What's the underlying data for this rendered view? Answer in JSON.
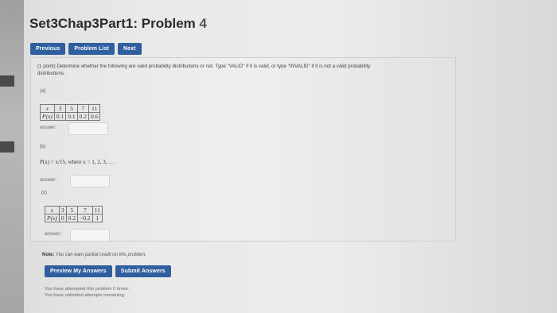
{
  "header": {
    "title": "Set3Chap3Part1: Problem",
    "problem_number": "4"
  },
  "nav": {
    "previous": "Previous",
    "problem_list": "Problem List",
    "next": "Next"
  },
  "problem": {
    "intro_line1": "(1 point) Determine whether the following are valid probability distributions or not. Type \"VALID\" if it is valid, or type \"INVALID\" if it is not a valid probability",
    "intro_line2": "distributions.",
    "answer_label": "answer:",
    "part_a": {
      "label": "(a)",
      "row_x": [
        "x",
        "3",
        "5",
        "7",
        "11"
      ],
      "row_p": [
        "P(x)",
        "0.1",
        "0.1",
        "0.2",
        "0.6"
      ]
    },
    "part_b": {
      "label": "(b)",
      "formula": "P(x) = x/15, where x = 1, 2, 3, . . ."
    },
    "part_c": {
      "label": "(c)",
      "row_x": [
        "x",
        "3",
        "5",
        "7",
        "11"
      ],
      "row_p": [
        "P(x)",
        "0",
        "0.2",
        "−0.2",
        "1"
      ]
    }
  },
  "note": {
    "bold": "Note:",
    "text": " You can earn partial credit on this problem."
  },
  "actions": {
    "preview": "Preview My Answers",
    "submit": "Submit Answers"
  },
  "attempts": {
    "line1": "You have attempted this problem 0 times.",
    "line2": "You have unlimited attempts remaining."
  },
  "colors": {
    "button_blue": "#2f5f9e"
  }
}
